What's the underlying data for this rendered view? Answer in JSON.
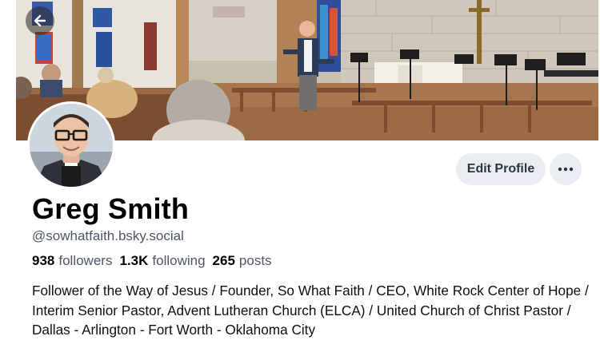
{
  "profile": {
    "display_name": "Greg Smith",
    "handle": "@sowhatfaith.bsky.social",
    "bio": "Follower of the Way of Jesus /  Founder, So What Faith / CEO, White Rock Center of Hope / Interim Senior Pastor, Advent Lutheran Church (ELCA) / United Church of Christ Pastor / Dallas - Arlington - Fort Worth - Oklahoma City"
  },
  "stats": {
    "followers_count": "938",
    "followers_label": "followers",
    "following_count": "1.3K",
    "following_label": "following",
    "posts_count": "265",
    "posts_label": "posts"
  },
  "actions": {
    "edit_profile_label": "Edit Profile",
    "more_icon": "ellipsis-icon",
    "back_icon": "arrow-left-icon"
  },
  "colors": {
    "button_bg": "#e9edf1",
    "secondary_text": "#4d5763",
    "primary_text": "#000000"
  }
}
